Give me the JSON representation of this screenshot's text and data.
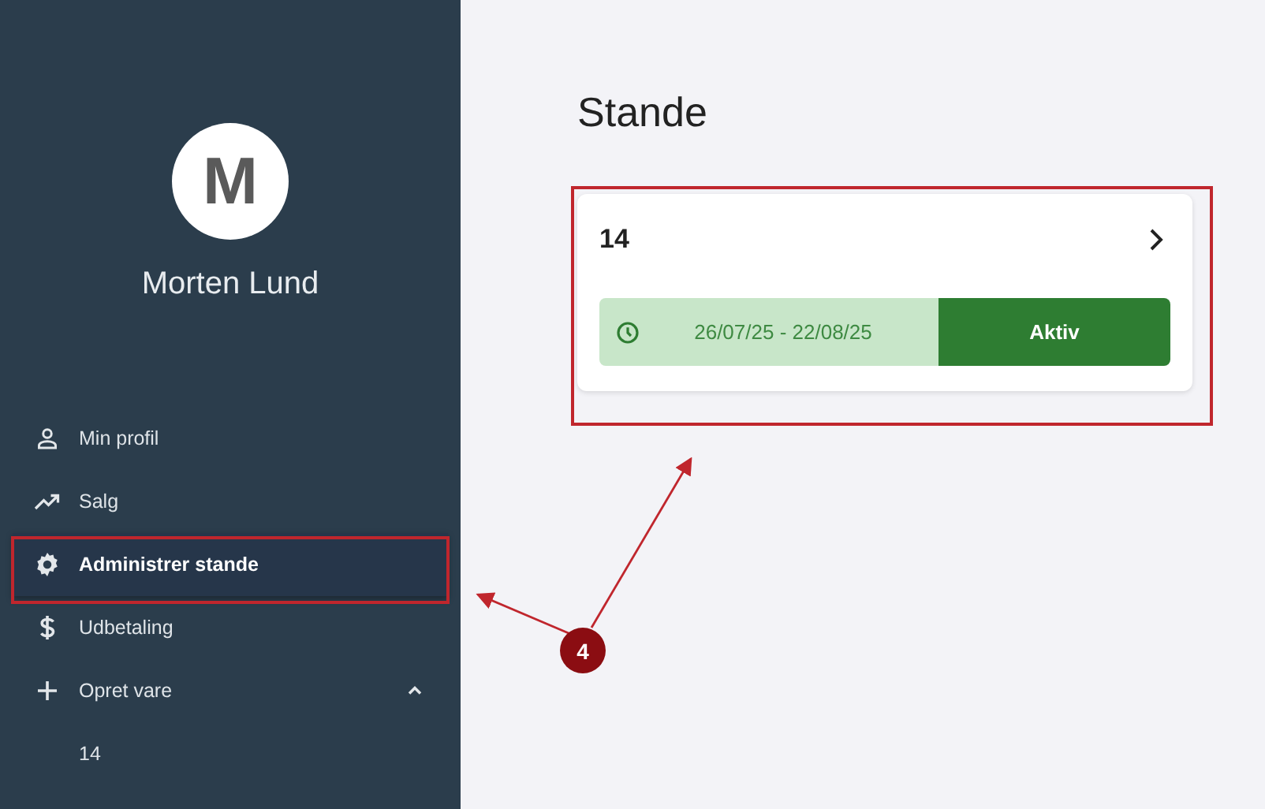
{
  "sidebar": {
    "avatar_initial": "M",
    "user_name": "Morten Lund",
    "items": [
      {
        "label": "Min profil",
        "kind": "person",
        "selected": false
      },
      {
        "label": "Salg",
        "kind": "trend",
        "selected": false
      },
      {
        "label": "Administrer stande",
        "kind": "gear",
        "selected": true
      },
      {
        "label": "Udbetaling",
        "kind": "dollar",
        "selected": false
      },
      {
        "label": "Opret vare",
        "kind": "plus",
        "selected": false,
        "expanded": true,
        "children": [
          {
            "label": "14",
            "selected": false
          }
        ]
      }
    ]
  },
  "main": {
    "title": "Stande",
    "cards": [
      {
        "name": "14",
        "period": "26/07/25 - 22/08/25",
        "status": "Aktiv"
      }
    ]
  },
  "annotations": {
    "callout": "4"
  }
}
